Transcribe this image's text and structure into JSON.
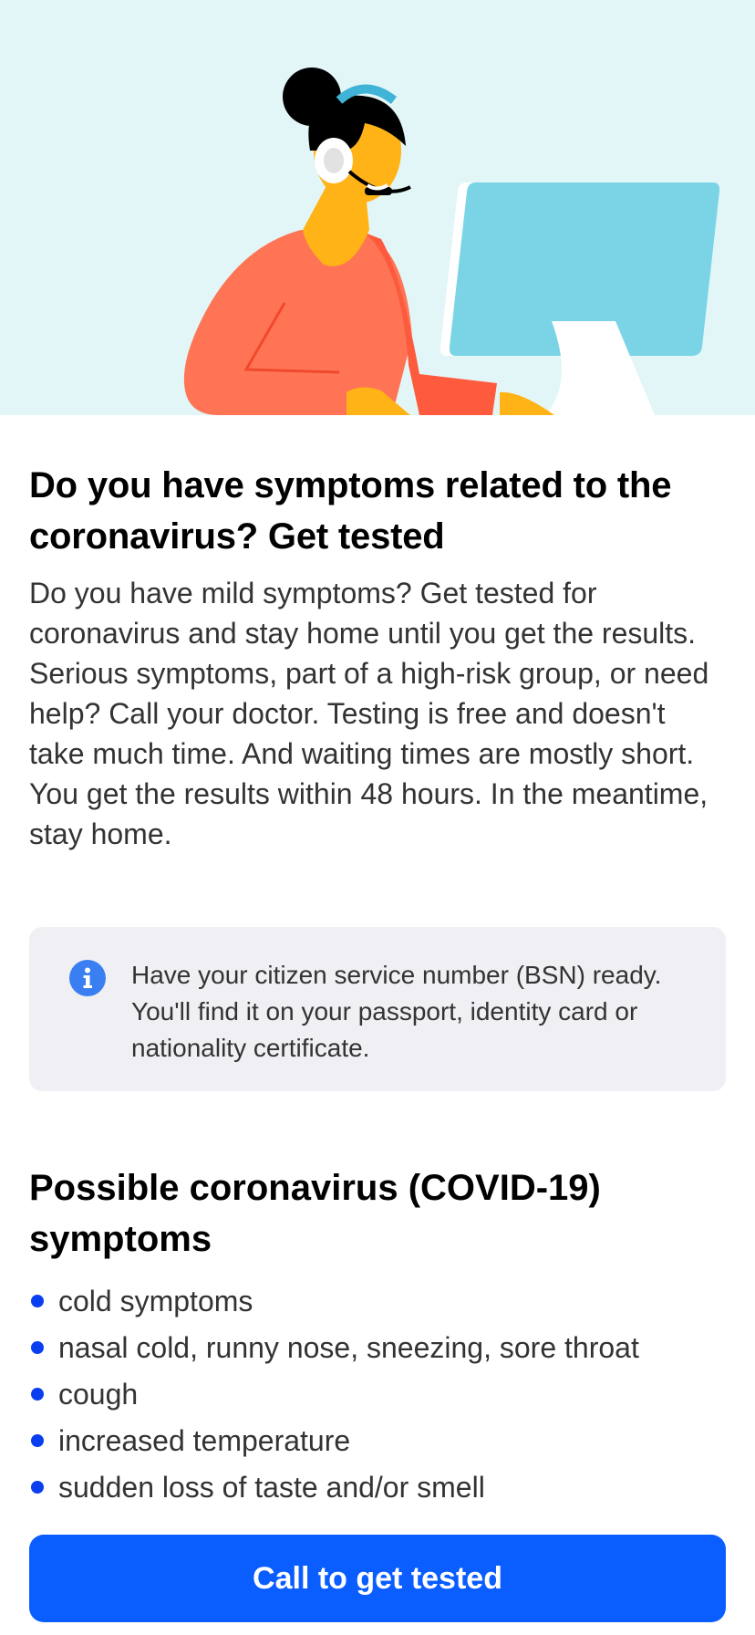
{
  "hero": {
    "illustration": "support-agent-at-computer",
    "background_color": "#e2f6f7"
  },
  "intro": {
    "title": "Do you have symptoms related to the coronavirus? Get tested",
    "body": "Do you have mild symptoms? Get tested for coronavirus and stay home until you get the results. Serious symptoms, part of a high-risk group, or need help? Call your doctor. Testing is free and doesn't take much time. And waiting times are mostly short. You get the results within 48 hours. In the meantime, stay home."
  },
  "info": {
    "icon": "info-icon",
    "text": "Have your citizen service number (BSN) ready. You'll find it on your passport, identity card or nationality certificate."
  },
  "symptoms": {
    "title": "Possible coronavirus (COVID-19) symptoms",
    "items": [
      {
        "label": "cold symptoms"
      },
      {
        "label": "nasal cold, runny nose, sneezing, sore throat"
      },
      {
        "label": "cough"
      },
      {
        "label": "increased temperature"
      },
      {
        "label": "sudden loss of taste and/or smell"
      }
    ]
  },
  "cta": {
    "label": "Call to get tested",
    "color": "#0a5dff"
  },
  "colors": {
    "bullet": "#0a3ff0",
    "info_icon": "#3a7ff2",
    "info_box": "#efeff4"
  }
}
